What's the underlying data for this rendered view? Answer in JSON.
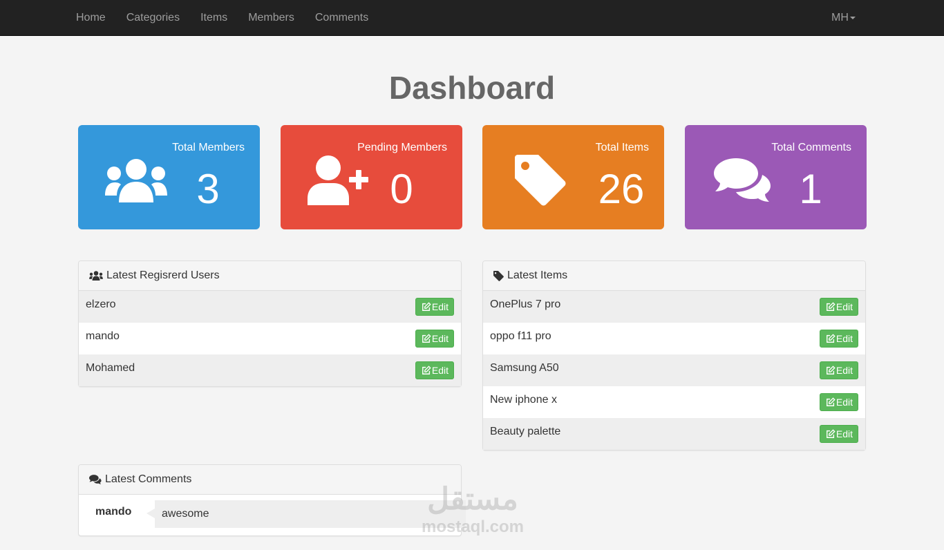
{
  "nav": {
    "links": [
      "Home",
      "Categories",
      "Items",
      "Members",
      "Comments"
    ],
    "user": "MH"
  },
  "page": {
    "title": "Dashboard"
  },
  "stats": [
    {
      "label": "Total Members",
      "value": "3",
      "color": "#3498db",
      "icon": "users-icon"
    },
    {
      "label": "Pending Members",
      "value": "0",
      "color": "#e74c3c",
      "icon": "user-plus-icon"
    },
    {
      "label": "Total Items",
      "value": "26",
      "color": "#e67e22",
      "icon": "tag-icon"
    },
    {
      "label": "Total Comments",
      "value": "1",
      "color": "#9b59b6",
      "icon": "comments-icon"
    }
  ],
  "latest_users": {
    "title": "Latest Regisrerd Users",
    "rows": [
      "elzero",
      "mando",
      "Mohamed"
    ]
  },
  "latest_items": {
    "title": "Latest Items",
    "rows": [
      "OnePlus 7 pro",
      "oppo f11 pro",
      "Samsung A50",
      "New iphone x",
      "Beauty palette"
    ]
  },
  "latest_comments": {
    "title": "Latest Comments",
    "comment": {
      "user": "mando",
      "text": "awesome"
    }
  },
  "buttons": {
    "edit": "Edit"
  },
  "watermark": {
    "logo": "مستقل",
    "text": "mostaql.com"
  },
  "colors": {
    "navbar": "#222222",
    "edit_button": "#5cb85c",
    "title": "#666666"
  }
}
